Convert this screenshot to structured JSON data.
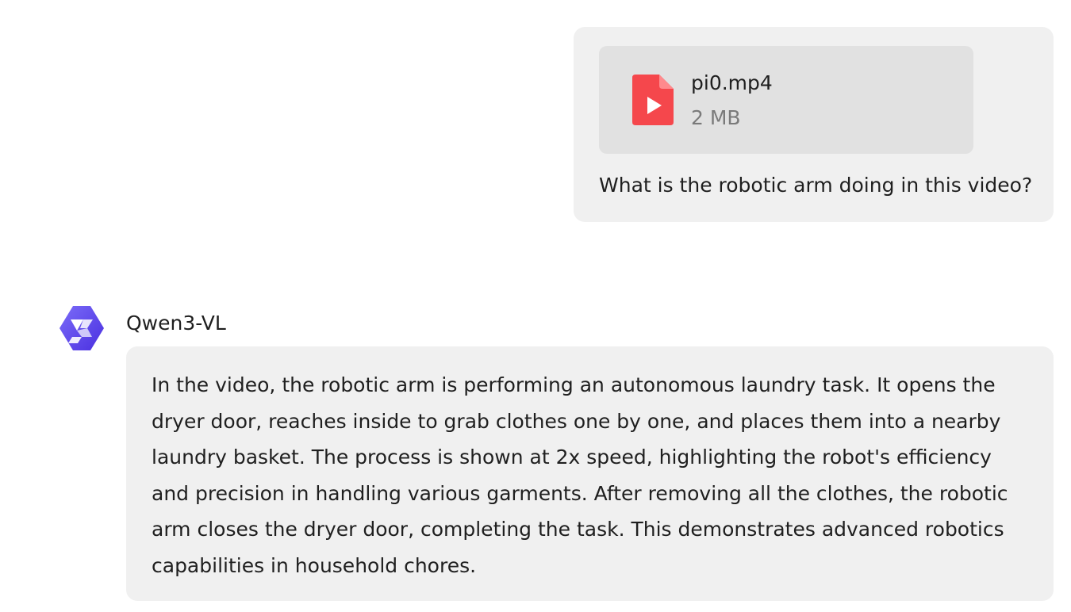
{
  "user_message": {
    "attachment": {
      "file_name": "pi0.mp4",
      "file_size": "2 MB",
      "icon": "video-file-icon",
      "icon_color": "#f5474c"
    },
    "text": "What is the robotic arm doing in this video?"
  },
  "assistant_message": {
    "name": "Qwen3-VL",
    "avatar_icon": "qwen-logo-icon",
    "avatar_color": "#6a52f4",
    "text": "In the video, the robotic arm is performing an autonomous laundry task. It opens the dryer door, reaches inside to grab clothes one by one, and places them into a nearby laundry basket. The process is shown at 2x speed, highlighting the robot's efficiency and precision in handling various garments. After removing all the clothes, the robotic arm closes the dryer door, completing the task. This demonstrates advanced robotics capabilities in household chores."
  }
}
